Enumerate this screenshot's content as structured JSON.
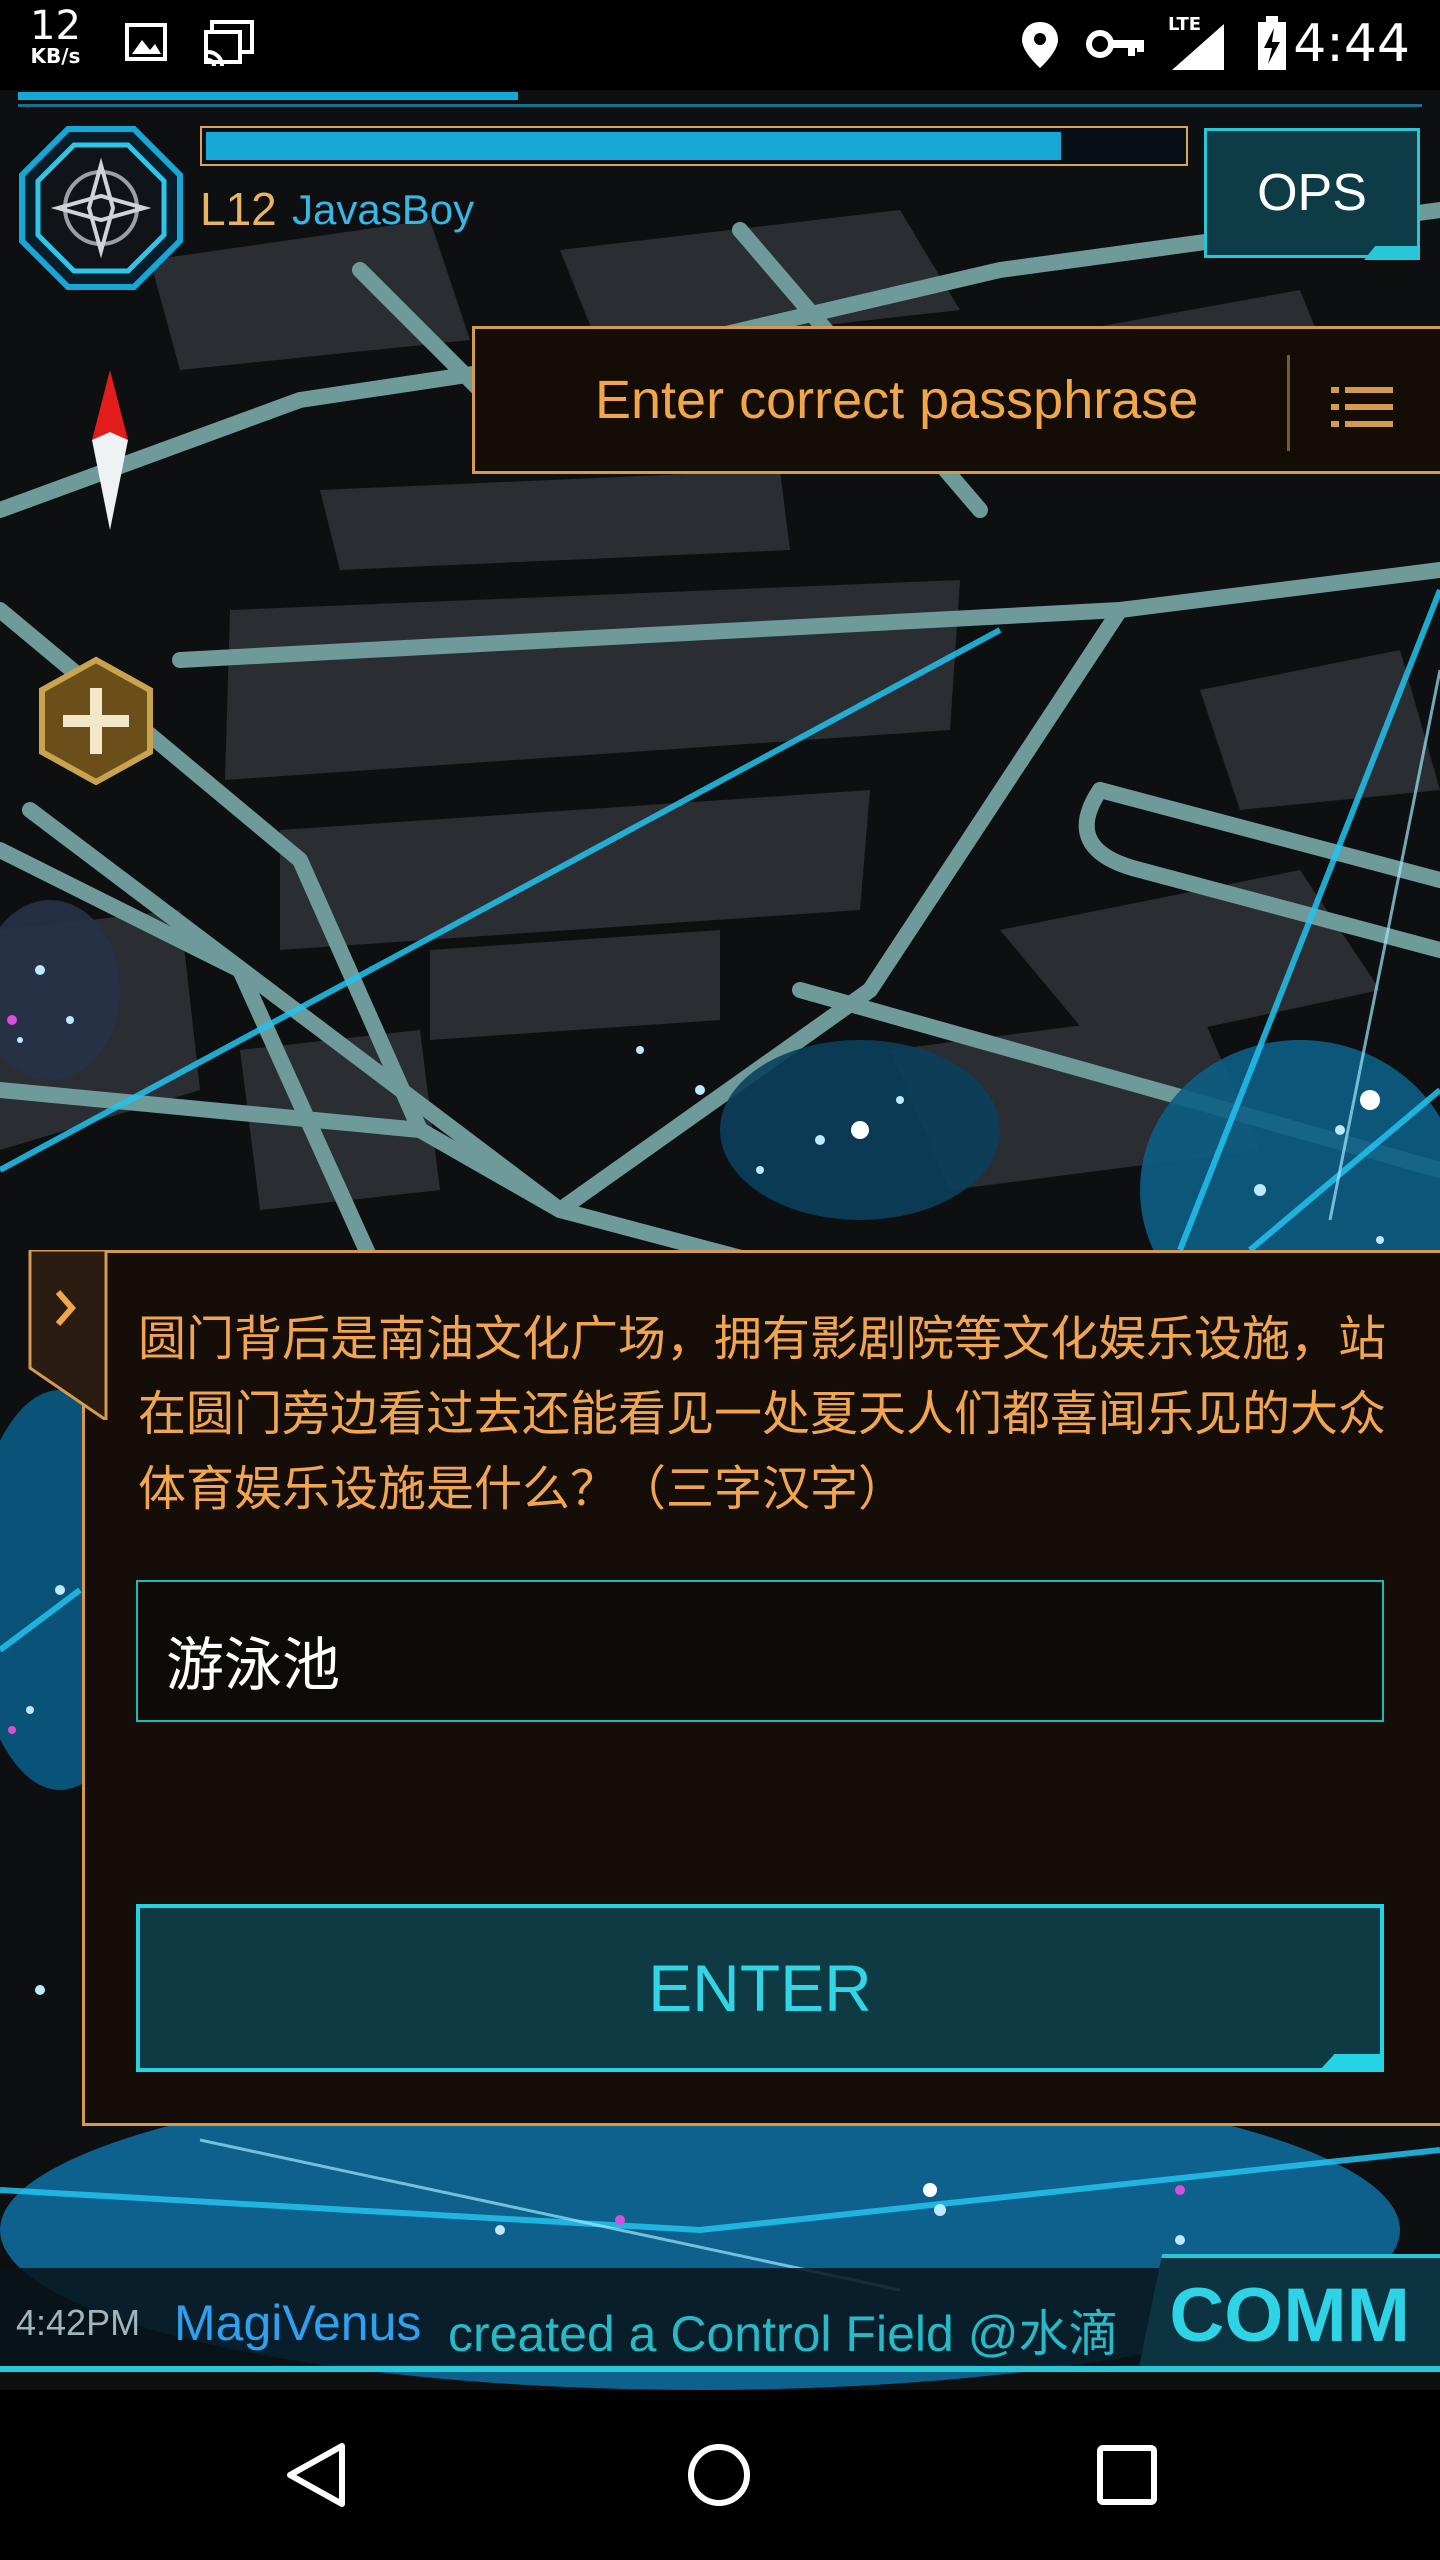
{
  "status_bar": {
    "net_speed": "12",
    "net_unit": "KB/s",
    "network_label": "LTE",
    "time": "4:44",
    "icons": [
      "image-icon",
      "cast-icon",
      "location-icon",
      "key-icon",
      "signal-icon",
      "battery-icon"
    ]
  },
  "hud": {
    "level": "L12",
    "agent_name": "JavasBoy",
    "ops_label": "OPS",
    "xp_fraction": 0.88
  },
  "passcode": {
    "title": "Enter correct passphrase"
  },
  "dialog": {
    "question": "圆门背后是南油文化广场，拥有影剧院等文化娱乐设施，站在圆门旁边看过去还能看见一处夏天人们都喜闻乐见的大众体育娱乐设施是什么？（三字汉字）",
    "answer_value": "游泳池",
    "enter_label": "ENTER"
  },
  "comm": {
    "timestamp": "4:42PM",
    "agent": "MagiVenus",
    "message": "created a Control Field @水滴",
    "button_label": "COMM"
  },
  "colors": {
    "accent_cyan": "#27c7d8",
    "accent_orange": "#d49a4e",
    "resistance_blue": "#17a7d6"
  }
}
